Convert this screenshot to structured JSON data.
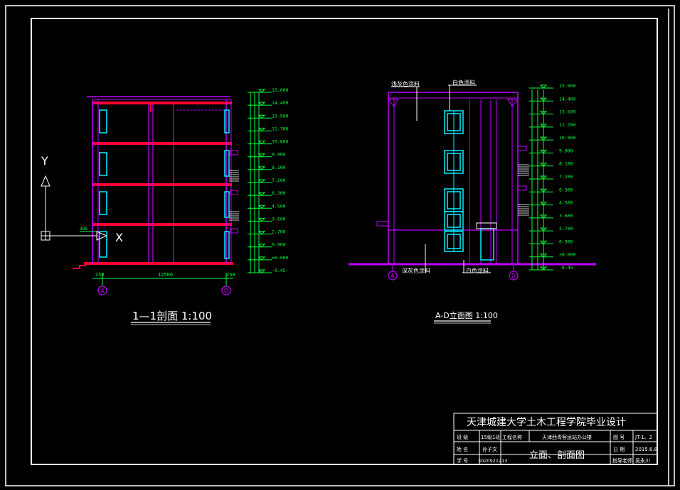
{
  "section_1": {
    "title": "1—1剖面 1:100",
    "axis_left": "A",
    "axis_right": "D",
    "span_left": "250",
    "span_mid": "12500",
    "span_right": "250",
    "elevations": [
      "15.000",
      "14.400",
      "13.500",
      "11.700",
      "10.800",
      "9.900",
      "8.100",
      "7.200",
      "6.300",
      "4.500",
      "3.600",
      "2.700",
      "0.900",
      "±0.000",
      "-0.45"
    ]
  },
  "elevation_view": {
    "title": "A-D立面图 1:100",
    "axis_left": "A",
    "axis_right": "D",
    "callout_1": "浅灰色涂料",
    "callout_2": "白色涂料",
    "callout_3": "深灰色涂料",
    "callout_4": "白色涂料",
    "elevations": [
      "15.000",
      "14.400",
      "13.500",
      "11.700",
      "10.800",
      "9.900",
      "8.100",
      "7.200",
      "6.300",
      "4.500",
      "3.600",
      "2.700",
      "0.900",
      "±0.000",
      "-0.45"
    ]
  },
  "ucs": {
    "x_label": "X",
    "y_label": "Y"
  },
  "title_block": {
    "school": "天津城建大学土木工程学院毕业设计",
    "row1_lbl": "班  级",
    "row1_val": "15级1班",
    "row1_lbl2": "工程名称",
    "row1_proj": "天津西青客运站办公楼",
    "row1_lbl3": "图  号",
    "row1_no": "JT-1、2",
    "row2_lbl": "姓  名",
    "row2_val": "孙子文",
    "drawing_name": "立面、剖面图",
    "row2_lbl3": "日  期",
    "row2_date": "2015.6.8",
    "row3_lbl": "学  号",
    "row3_val": "3020921213",
    "row3_lbl3": "指导老师",
    "row3_teacher": "吴永川"
  },
  "colors": {
    "frame": "#ffffff",
    "beam": "#ff0030",
    "column": "#c000ff",
    "window": "#00f0ff",
    "dim": "#00ff3c"
  }
}
